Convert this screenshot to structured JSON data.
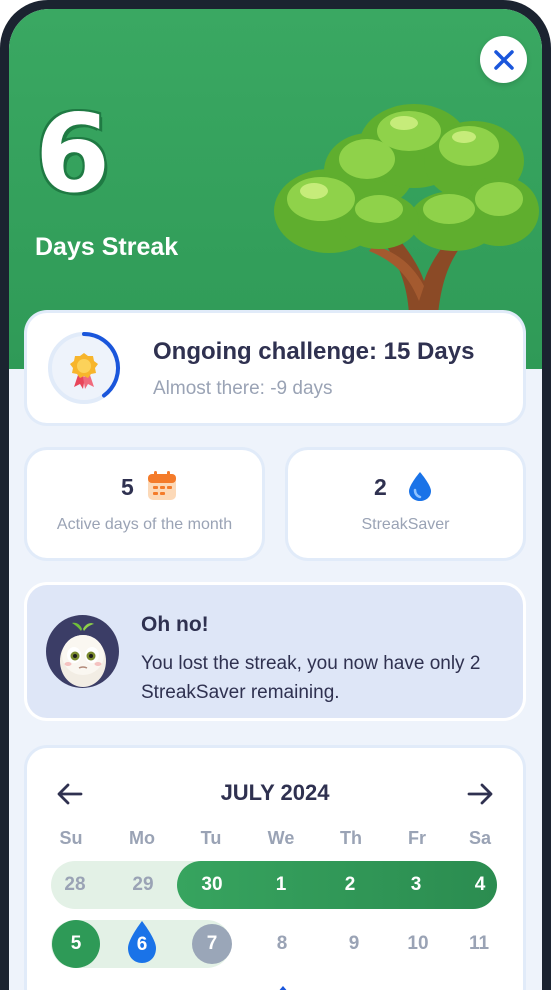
{
  "header": {
    "streak_count": "6",
    "streak_label": "Days Streak"
  },
  "challenge": {
    "title": "Ongoing challenge: 15 Days",
    "subtitle": "Almost there: -9 days",
    "progress": 0.4
  },
  "stats": [
    {
      "value": "5",
      "label": "Active days of the month",
      "icon": "calendar-icon"
    },
    {
      "value": "2",
      "label": "StreakSaver",
      "icon": "water-drop-icon"
    }
  ],
  "alert": {
    "title": "Oh no!",
    "message": "You lost the streak, you now have only 2 StreakSaver remaining."
  },
  "calendar": {
    "month": "JULY 2024",
    "weekdays": [
      "Su",
      "Mo",
      "Tu",
      "We",
      "Th",
      "Fr",
      "Sa"
    ],
    "week1": [
      "28",
      "29",
      "30",
      "1",
      "2",
      "3",
      "4"
    ],
    "week2": [
      "5",
      "6",
      "7",
      "8",
      "9",
      "10",
      "11"
    ]
  },
  "colors": {
    "brand_green": "#2f9a57",
    "accent_blue": "#1a73e8",
    "text_dark": "#2f3150",
    "text_muted": "#9aa3b5"
  }
}
